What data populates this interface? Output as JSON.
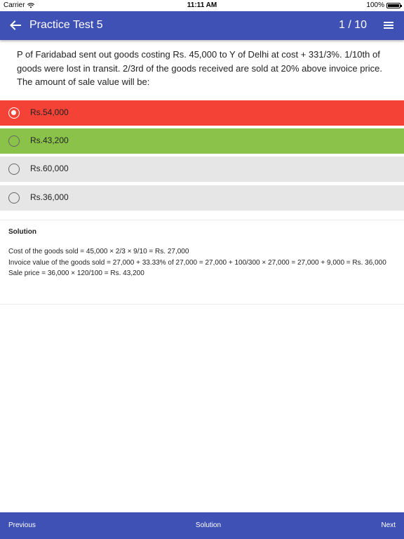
{
  "status_bar": {
    "carrier": "Carrier",
    "time": "11:11 AM",
    "battery": "100%",
    "battery_level": 1.0
  },
  "app_bar": {
    "title": "Practice Test 5",
    "counter": "1 / 10",
    "back_icon": "arrow-left-icon",
    "menu_icon": "hamburger-menu-icon"
  },
  "question": {
    "text": "P of Faridabad sent out goods costing Rs. 45,000 to Y of Delhi at cost + 331/3%. 1/10th of goods were lost in transit. 2/3rd of the goods received are sold at 20% above invoice price. The amount of sale value will be:"
  },
  "options": [
    {
      "label": "Rs.54,000",
      "selected": true,
      "state": "wrong",
      "color": "#f44336"
    },
    {
      "label": "Rs.43,200",
      "selected": false,
      "state": "correct",
      "color": "#8bc34a"
    },
    {
      "label": "Rs.60,000",
      "selected": false,
      "state": "neutral",
      "color": "#e6e6e6"
    },
    {
      "label": "Rs.36,000",
      "selected": false,
      "state": "neutral",
      "color": "#e6e6e6"
    }
  ],
  "solution": {
    "title": "Solution",
    "lines": [
      "Cost of the goods sold = 45,000 × 2/3 × 9/10 = Rs. 27,000",
      "Invoice value of the goods sold = 27,000 + 33.33% of 27,000 = 27,000 + 100/300 × 27,000 = 27,000 + 9,000 = Rs. 36,000",
      "Sale price = 36,000 × 120/100 = Rs. 43,200"
    ]
  },
  "bottom_bar": {
    "previous": "Previous",
    "solution": "Solution",
    "next": "Next"
  },
  "colors": {
    "primary": "#3f51b5",
    "wrong": "#f44336",
    "correct": "#8bc34a",
    "neutral": "#e6e6e6"
  }
}
